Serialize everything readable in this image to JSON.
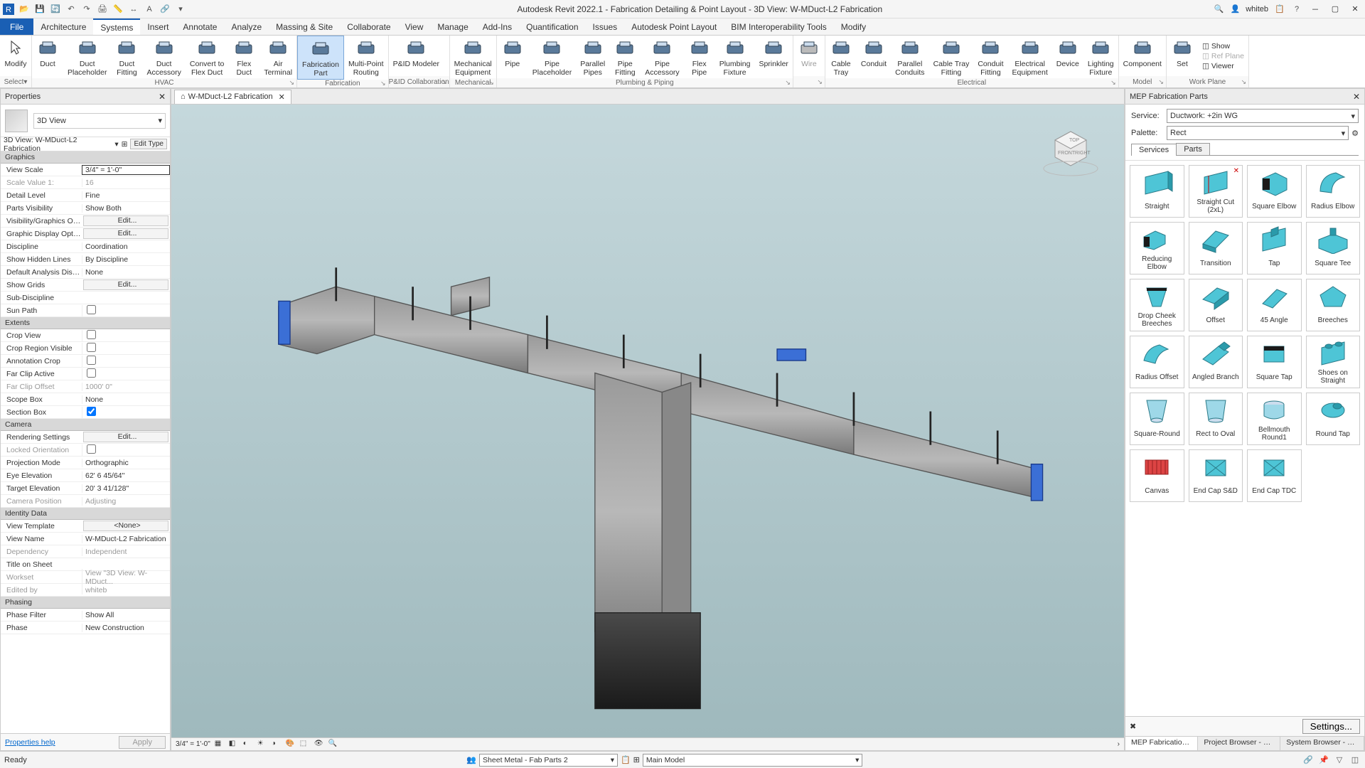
{
  "titlebar": {
    "title": "Autodesk Revit 2022.1 - Fabrication Detailing & Point Layout - 3D View: W-MDuct-L2 Fabrication",
    "user": "whiteb"
  },
  "tabs": {
    "file": "File",
    "items": [
      "Architecture",
      "Systems",
      "Insert",
      "Annotate",
      "Analyze",
      "Massing & Site",
      "Collaborate",
      "View",
      "Manage",
      "Add-Ins",
      "Quantification",
      "Issues",
      "Autodesk Point Layout",
      "BIM Interoperability Tools",
      "Modify"
    ],
    "active": "Systems"
  },
  "ribbon": {
    "modify": "Modify",
    "groups": [
      {
        "label": "HVAC",
        "buttons": [
          "Duct",
          "Duct\nPlaceholder",
          "Duct\nFitting",
          "Duct\nAccessory",
          "Convert to\nFlex Duct",
          "Flex\nDuct",
          "Air\nTerminal"
        ]
      },
      {
        "label": "Fabrication",
        "buttons": [
          "Fabrication\nPart",
          "Multi-Point\nRouting"
        ],
        "active": 0
      },
      {
        "label": "P&ID Collaboration",
        "buttons": [
          "P&ID Modeler"
        ]
      },
      {
        "label": "Mechanical",
        "buttons": [
          "Mechanical\nEquipment"
        ]
      },
      {
        "label": "Plumbing & Piping",
        "buttons": [
          "Pipe",
          "Pipe\nPlaceholder",
          "Parallel\nPipes",
          "Pipe\nFitting",
          "Pipe\nAccessory",
          "Flex\nPipe",
          "Plumbing\nFixture",
          "Sprinkler"
        ]
      },
      {
        "label": "",
        "buttons": [
          "Wire"
        ],
        "dim": true
      },
      {
        "label": "Electrical",
        "buttons": [
          "Cable\nTray",
          "Conduit",
          "Parallel\nConduits",
          "Cable Tray\nFitting",
          "Conduit\nFitting",
          "Electrical\nEquipment",
          "Device",
          "Lighting\nFixture"
        ]
      },
      {
        "label": "Model",
        "buttons": [
          "Component"
        ]
      },
      {
        "label": "Work Plane",
        "buttons": [
          "Set"
        ],
        "side": [
          "Show",
          "Ref Plane",
          "Viewer"
        ]
      }
    ],
    "select": "Select"
  },
  "properties": {
    "title": "Properties",
    "type": "3D View",
    "instance": "3D View: W-MDuct-L2 Fabrication",
    "editType": "Edit Type",
    "sections": [
      {
        "name": "Graphics",
        "rows": [
          {
            "l": "View Scale",
            "v": "3/4\" = 1'-0\"",
            "sel": true
          },
          {
            "l": "Scale Value    1:",
            "v": "16",
            "dim": true
          },
          {
            "l": "Detail Level",
            "v": "Fine"
          },
          {
            "l": "Parts Visibility",
            "v": "Show Both"
          },
          {
            "l": "Visibility/Graphics Overri...",
            "v": "Edit...",
            "btn": true
          },
          {
            "l": "Graphic Display Options",
            "v": "Edit...",
            "btn": true
          },
          {
            "l": "Discipline",
            "v": "Coordination"
          },
          {
            "l": "Show Hidden Lines",
            "v": "By Discipline"
          },
          {
            "l": "Default Analysis Display ...",
            "v": "None"
          },
          {
            "l": "Show Grids",
            "v": "Edit...",
            "btn": true
          },
          {
            "l": "Sub-Discipline",
            "v": ""
          },
          {
            "l": "Sun Path",
            "v": "",
            "chk": false
          }
        ]
      },
      {
        "name": "Extents",
        "rows": [
          {
            "l": "Crop View",
            "v": "",
            "chk": false
          },
          {
            "l": "Crop Region Visible",
            "v": "",
            "chk": false
          },
          {
            "l": "Annotation Crop",
            "v": "",
            "chk": false
          },
          {
            "l": "Far Clip Active",
            "v": "",
            "chk": false
          },
          {
            "l": "Far Clip Offset",
            "v": "1000'  0\"",
            "dim": true
          },
          {
            "l": "Scope Box",
            "v": "None"
          },
          {
            "l": "Section Box",
            "v": "",
            "chk": true
          }
        ]
      },
      {
        "name": "Camera",
        "rows": [
          {
            "l": "Rendering Settings",
            "v": "Edit...",
            "btn": true
          },
          {
            "l": "Locked Orientation",
            "v": "",
            "chk": false,
            "dim": true
          },
          {
            "l": "Projection Mode",
            "v": "Orthographic"
          },
          {
            "l": "Eye Elevation",
            "v": "62'  6 45/64\""
          },
          {
            "l": "Target Elevation",
            "v": "20'  3 41/128\""
          },
          {
            "l": "Camera Position",
            "v": "Adjusting",
            "dim": true
          }
        ]
      },
      {
        "name": "Identity Data",
        "rows": [
          {
            "l": "View Template",
            "v": "<None>",
            "btn": true
          },
          {
            "l": "View Name",
            "v": "W-MDuct-L2 Fabrication"
          },
          {
            "l": "Dependency",
            "v": "Independent",
            "dim": true
          },
          {
            "l": "Title on Sheet",
            "v": ""
          },
          {
            "l": "Workset",
            "v": "View \"3D View: W-MDuct...",
            "dim": true
          },
          {
            "l": "Edited by",
            "v": "whiteb",
            "dim": true
          }
        ]
      },
      {
        "name": "Phasing",
        "rows": [
          {
            "l": "Phase Filter",
            "v": "Show All"
          },
          {
            "l": "Phase",
            "v": "New Construction"
          }
        ]
      }
    ],
    "help": "Properties help",
    "apply": "Apply"
  },
  "viewTab": "W-MDuct-L2 Fabrication",
  "viewScale": "3/4\" = 1'-0\"",
  "fab": {
    "title": "MEP Fabrication Parts",
    "serviceLabel": "Service:",
    "service": "Ductwork: +2in WG",
    "paletteLabel": "Palette:",
    "palette": "Rect",
    "tabs": [
      "Services",
      "Parts"
    ],
    "activeTab": "Services",
    "parts": [
      "Straight",
      "Straight Cut (2xL)",
      "Square Elbow",
      "Radius Elbow",
      "Reducing Elbow",
      "Transition",
      "Tap",
      "Square Tee",
      "Drop Cheek Breeches",
      "Offset",
      "45 Angle",
      "Breeches",
      "Radius Offset",
      "Angled Branch",
      "Square Tap",
      "Shoes on Straight",
      "Square-Round",
      "Rect to Oval",
      "Bellmouth Round1",
      "Round Tap",
      "Canvas",
      "End Cap S&D",
      "End Cap TDC"
    ],
    "settings": "Settings..."
  },
  "bottomTabs": [
    "MEP Fabrication Parts",
    "Project Browser - Fabric...",
    "System Browser - Fabric..."
  ],
  "status": {
    "ready": "Ready",
    "sheet": "Sheet Metal - Fab Parts 2",
    "model": "Main Model"
  }
}
